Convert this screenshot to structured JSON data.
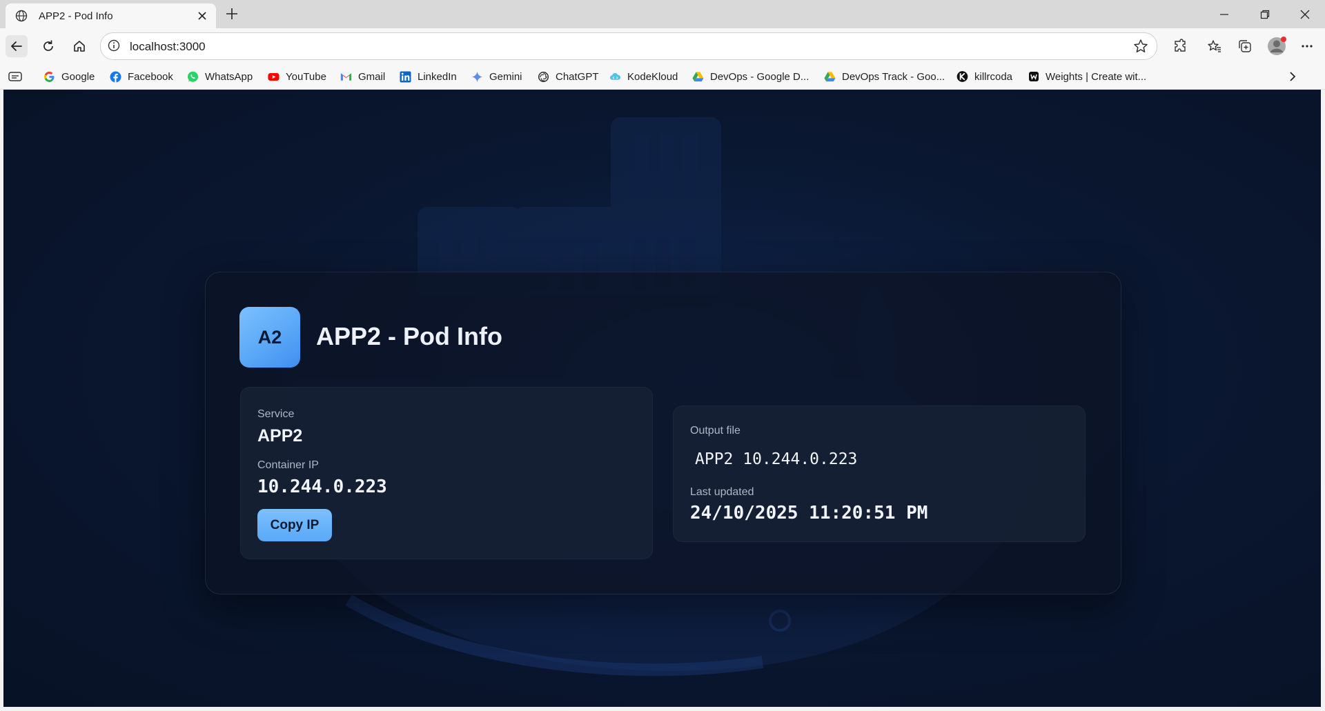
{
  "browser": {
    "tab_title": "APP2 - Pod Info",
    "url": "localhost:3000",
    "bookmarks": [
      {
        "label": "Google",
        "icon": "google-icon"
      },
      {
        "label": "Facebook",
        "icon": "facebook-icon"
      },
      {
        "label": "WhatsApp",
        "icon": "whatsapp-icon"
      },
      {
        "label": "YouTube",
        "icon": "youtube-icon"
      },
      {
        "label": "Gmail",
        "icon": "gmail-icon"
      },
      {
        "label": "LinkedIn",
        "icon": "linkedin-icon"
      },
      {
        "label": "Gemini",
        "icon": "gemini-icon"
      },
      {
        "label": "ChatGPT",
        "icon": "chatgpt-icon"
      },
      {
        "label": "KodeKloud",
        "icon": "kodekloud-icon"
      },
      {
        "label": "DevOps  - Google D...",
        "icon": "google-drive-icon"
      },
      {
        "label": "DevOps Track - Goo...",
        "icon": "google-drive-icon"
      },
      {
        "label": "killrcoda",
        "icon": "killercoda-icon"
      },
      {
        "label": "Weights | Create wit...",
        "icon": "weights-icon"
      }
    ]
  },
  "page": {
    "logo_text": "A2",
    "title": "APP2 - Pod Info",
    "service_label": "Service",
    "service_value": "APP2",
    "ip_label": "Container IP",
    "ip_value": "10.244.0.223",
    "copy_button": "Copy IP",
    "output_label": "Output file",
    "output_value": "APP2 10.244.0.223",
    "updated_label": "Last updated",
    "updated_value": "24/10/2025 11:20:51 PM"
  },
  "colors": {
    "accent": "#5aa8f7",
    "background": "#0a1730",
    "panel": "#0c1426",
    "card": "#182236"
  }
}
